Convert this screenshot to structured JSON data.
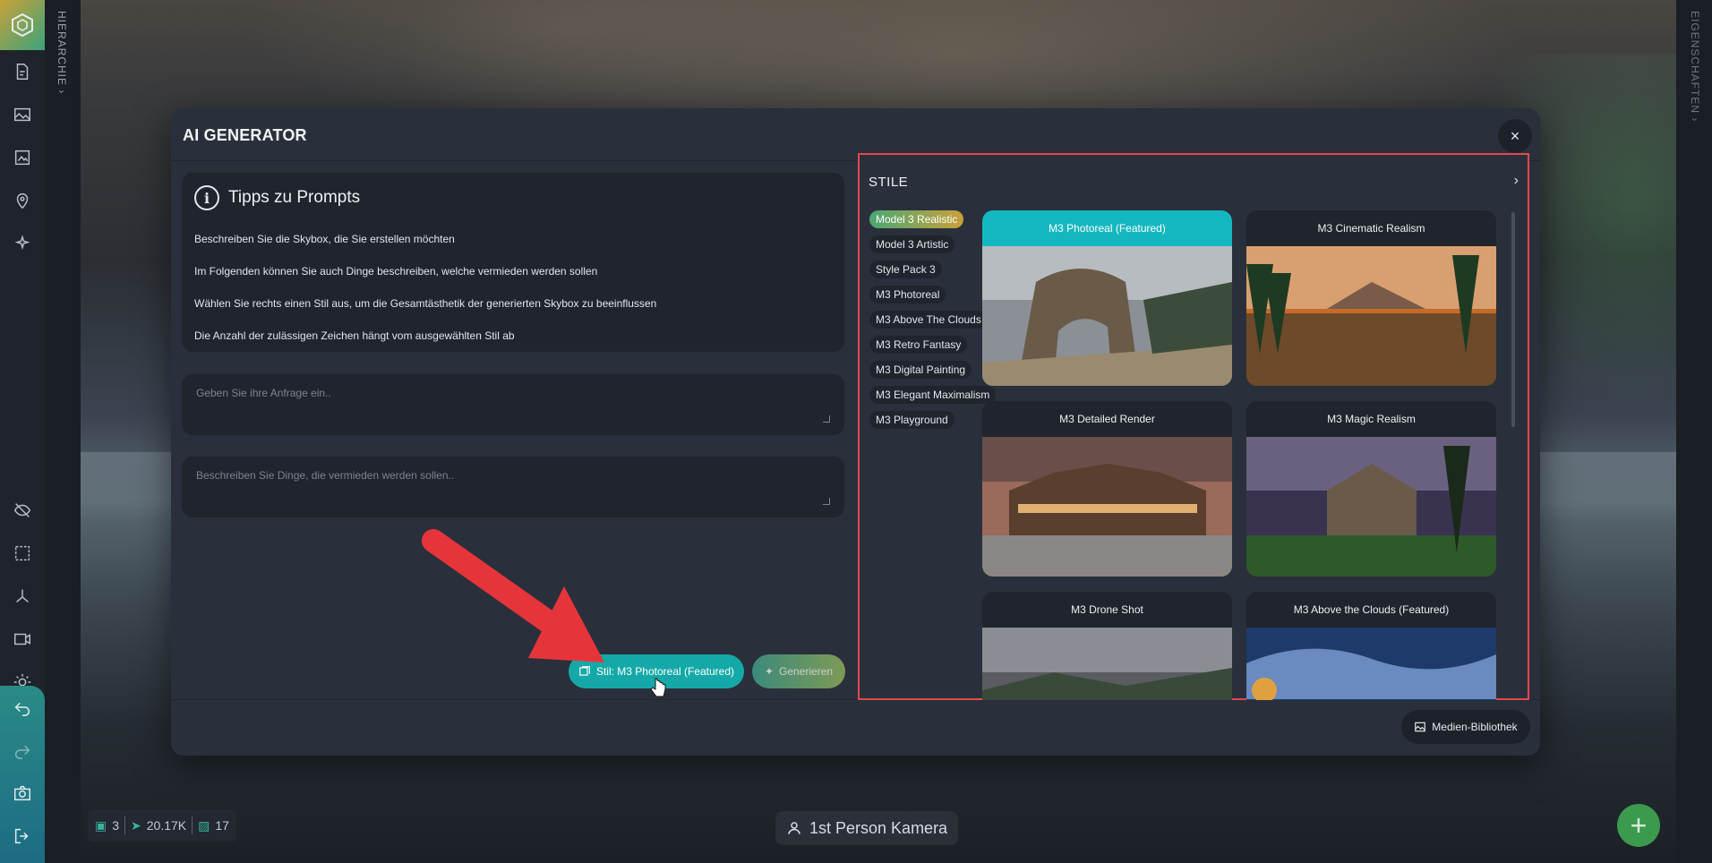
{
  "left_toolbar": {
    "tools": [
      "files-icon",
      "image-icon",
      "gallery-icon",
      "map-pin-plus-icon",
      "sparkle-icon",
      "hide-icon",
      "select-region-icon",
      "transform-icon",
      "video-icon",
      "sun-icon"
    ],
    "bottom_tools": [
      "undo-icon",
      "redo-icon",
      "camera-icon",
      "logout-icon"
    ]
  },
  "hierarchy_label": "HIERARCHIE ›",
  "properties_label": "EIGENSCHAFTEN ›",
  "modal": {
    "title": "AI GENERATOR",
    "close": "×",
    "tips": {
      "title": "Tipps zu Prompts",
      "lines": [
        "Beschreiben Sie die Skybox, die Sie erstellen möchten",
        "Im Folgenden können Sie auch Dinge beschreiben, welche vermieden werden sollen",
        "Wählen Sie rechts einen Stil aus, um die Gesamtästhetik der generierten Skybox zu beeinflussen",
        "Die Anzahl der zulässigen Zeichen hängt vom ausgewählten Stil ab"
      ]
    },
    "prompt_placeholder": "Geben Sie ihre Anfrage ein..",
    "negative_placeholder": "Beschreiben Sie Dinge, die vermieden werden sollen..",
    "style_button": "Stil: M3 Photoreal (Featured)",
    "generate_button": "Generieren",
    "media_button": "Medien-Bibliothek"
  },
  "styles": {
    "title": "STILE",
    "categories": [
      "Model 3 Realistic",
      "Model 3 Artistic",
      "Style Pack 3",
      "M3 Photoreal",
      "M3 Above The Clouds",
      "M3 Retro Fantasy",
      "M3 Digital Painting",
      "M3 Elegant Maximalism",
      "M3 Playground"
    ],
    "active_category": "Model 3 Realistic",
    "cards": [
      "M3 Photoreal (Featured)",
      "M3 Cinematic Realism",
      "M3 Detailed Render",
      "M3 Magic Realism",
      "M3 Drone Shot",
      "M3 Above the Clouds (Featured)"
    ],
    "selected_card": "M3 Photoreal (Featured)"
  },
  "stats": {
    "a": "3",
    "b": "20.17K",
    "c": "17"
  },
  "camera_label": "1st Person Kamera",
  "colors": {
    "accent": "#14a9a8",
    "highlight_border": "#e3474d",
    "add_button": "#3c9a4e"
  }
}
